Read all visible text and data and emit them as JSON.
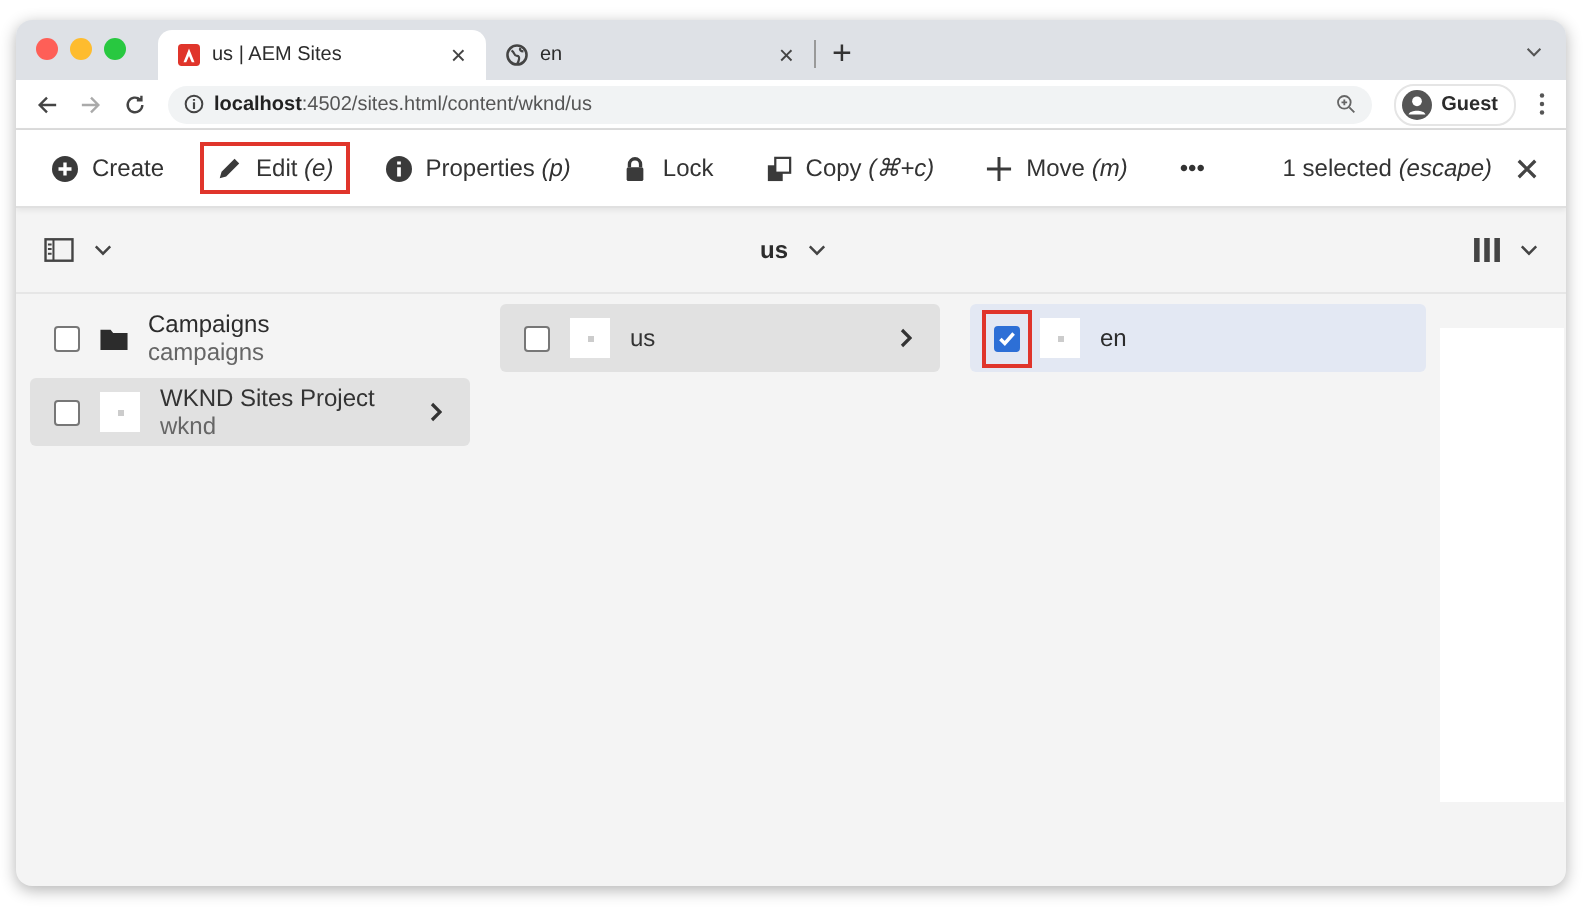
{
  "browser": {
    "tabs": [
      {
        "title": "us | AEM Sites",
        "close": "×",
        "selected": true
      },
      {
        "title": "en",
        "close": "×",
        "selected": false
      }
    ],
    "new_tab": "+",
    "address": {
      "host": "localhost",
      "rest": ":4502/sites.html/content/wknd/us"
    },
    "profile": "Guest"
  },
  "toolbar": {
    "actions": [
      {
        "label": "Create",
        "highlighted": false
      },
      {
        "label": "Edit *(e)*",
        "highlighted": true
      },
      {
        "label": "Properties *(p)*",
        "highlighted": false
      },
      {
        "label": "Lock",
        "highlighted": false
      },
      {
        "label": "Copy *(⌘+c)*",
        "highlighted": false
      },
      {
        "label": "Move *(m)*",
        "highlighted": false
      },
      {
        "label": "•••",
        "highlighted": false
      }
    ],
    "selection": "1 selected *(escape)*"
  },
  "header": {
    "title": "us"
  },
  "columns": [
    {
      "items": [
        {
          "kind": "folder",
          "title": "Campaigns",
          "subtitle": "campaigns",
          "checked": false,
          "selected": false,
          "has_children": false,
          "highlighted": false
        },
        {
          "kind": "page",
          "title": "WKND Sites Project",
          "subtitle": "wknd",
          "checked": false,
          "selected": true,
          "has_children": true,
          "highlighted": false
        }
      ]
    },
    {
      "items": [
        {
          "kind": "page",
          "title": "us",
          "checked": false,
          "selected": true,
          "has_children": true,
          "highlighted": false
        }
      ]
    },
    {
      "items": [
        {
          "kind": "page",
          "title": "en",
          "checked": true,
          "selected": true,
          "has_children": false,
          "highlighted": true
        }
      ]
    }
  ]
}
